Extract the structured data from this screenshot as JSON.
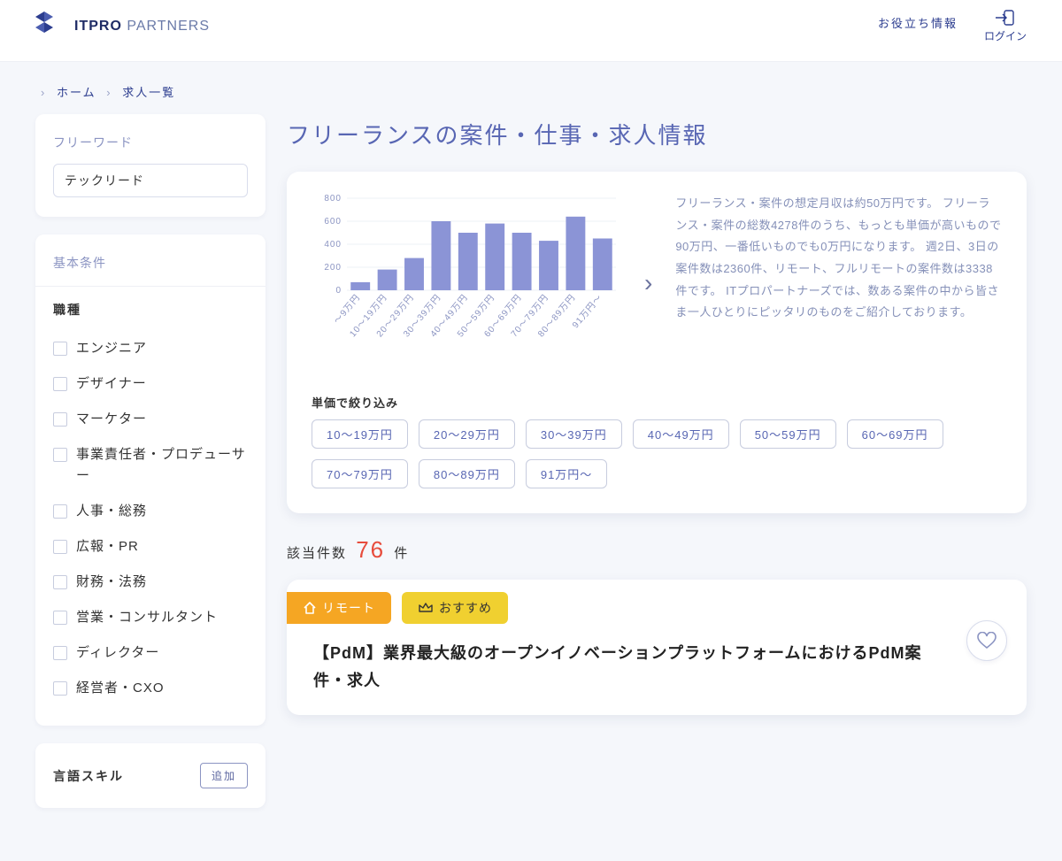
{
  "header": {
    "logo_strong": "ITPRO",
    "logo_light": " PARTNERS",
    "info_link": "お役立ち情報",
    "login": "ログイン"
  },
  "breadcrumb": {
    "home": "ホーム",
    "current": "求人一覧"
  },
  "sidebar": {
    "freeword_label": "フリーワード",
    "freeword_value": "テックリード",
    "basic_label": "基本条件",
    "jobtype_label": "職種",
    "jobtypes": [
      "エンジニア",
      "デザイナー",
      "マーケター",
      "事業責任者・プロデューサー",
      "人事・総務",
      "広報・PR",
      "財務・法務",
      "営業・コンサルタント",
      "ディレクター",
      "経営者・CXO"
    ],
    "lang_label": "言語スキル",
    "add_btn": "追加"
  },
  "main": {
    "title": "フリーランスの案件・仕事・求人情報",
    "description": "フリーランス・案件の想定月収は約50万円です。 フリーランス・案件の総数4278件のうち、もっとも単価が高いもので90万円、一番低いものでも0万円になります。 週2日、3日の案件数は2360件、リモート、フルリモートの案件数は3338件です。 ITプロパートナーズでは、数ある案件の中から皆さま一人ひとりにピッタリのものをご紹介しております。",
    "filter_label": "単価で絞り込み",
    "price_chips": [
      "10〜19万円",
      "20〜29万円",
      "30〜39万円",
      "40〜49万円",
      "50〜59万円",
      "60〜69万円",
      "70〜79万円",
      "80〜89万円",
      "91万円〜"
    ],
    "count_prefix": "該当件数",
    "count_num": "76",
    "count_suffix": "件"
  },
  "job": {
    "tag_remote": "リモート",
    "tag_reco": "おすすめ",
    "title": "【PdM】業界最大級のオープンイノベーションプラットフォームにおけるPdM案件・求人"
  },
  "chart_data": {
    "type": "bar",
    "categories": [
      "〜9万円",
      "10〜19万円",
      "20〜29万円",
      "30〜39万円",
      "40〜49万円",
      "50〜59万円",
      "60〜69万円",
      "70〜79万円",
      "80〜89万円",
      "91万円〜"
    ],
    "values": [
      70,
      180,
      280,
      600,
      500,
      580,
      500,
      430,
      640,
      450
    ],
    "ylabel": "",
    "xlabel": "",
    "ylim": [
      0,
      800
    ],
    "yticks": [
      0,
      200,
      400,
      600,
      800
    ]
  }
}
